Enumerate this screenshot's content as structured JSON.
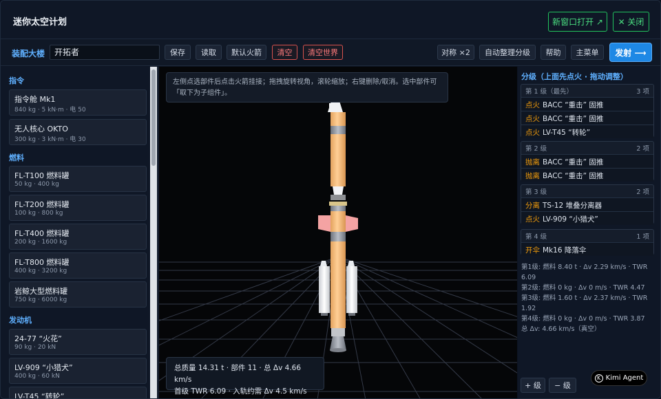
{
  "header": {
    "title": "迷你太空计划",
    "open_new_window": "新窗口打开 ↗",
    "close": "✕ 关闭"
  },
  "toolbar": {
    "vab_label": "装配大楼",
    "ship_name": "开拓者",
    "save": "保存",
    "load": "读取",
    "default_rocket": "默认火箭",
    "clear": "清空",
    "clear_world": "清空世界",
    "symmetry": "对称 ×2",
    "auto_stage": "自动整理分级",
    "help": "帮助",
    "main_menu": "主菜单",
    "launch": "发射 ⟶"
  },
  "parts_panel": {
    "categories": [
      {
        "name": "指令",
        "parts": [
          {
            "name": "指令舱 Mk1",
            "spec": "840 kg · 5 kN·m · 电 50"
          },
          {
            "name": "无人核心 OKTO",
            "spec": "300 kg · 3 kN·m · 电 30"
          }
        ]
      },
      {
        "name": "燃料",
        "parts": [
          {
            "name": "FL-T100 燃料罐",
            "spec": "50 kg · 400 kg"
          },
          {
            "name": "FL-T200 燃料罐",
            "spec": "100 kg · 800 kg"
          },
          {
            "name": "FL-T400 燃料罐",
            "spec": "200 kg · 1600 kg"
          },
          {
            "name": "FL-T800 燃料罐",
            "spec": "400 kg · 3200 kg"
          },
          {
            "name": "岩鲸大型燃料罐",
            "spec": "750 kg · 6000 kg"
          }
        ]
      },
      {
        "name": "发动机",
        "parts": [
          {
            "name": "24-77 “火花”",
            "spec": "90 kg · 20 kN"
          },
          {
            "name": "LV-909 “小猎犬”",
            "spec": "400 kg · 60 kN"
          },
          {
            "name": "LV-T45 “转轮”",
            "spec": ""
          }
        ]
      }
    ]
  },
  "viewport": {
    "hint": "左侧点选部件后点击火箭挂接；拖拽旋转视角，滚轮缩放；右键删除/取消。选中部件可「取下为子组件」。",
    "stats_line1": "总质量 14.31 t · 部件 11 · 总 Δv 4.66 km/s",
    "stats_line2": "首级 TWR 6.09 · 入轨约需 Δv 4.5 km/s"
  },
  "staging": {
    "title": "分级（上面先点火 · 拖动调整）",
    "stages": [
      {
        "label": "第 1 级（最先）",
        "count": "3 项",
        "items": [
          {
            "action": "点火",
            "part": "BACC “重击” 固推"
          },
          {
            "action": "点火",
            "part": "BACC “重击” 固推"
          },
          {
            "action": "点火",
            "part": "LV-T45 “转轮”"
          }
        ]
      },
      {
        "label": "第 2 级",
        "count": "2 项",
        "items": [
          {
            "action": "抛离",
            "part": "BACC “重击” 固推"
          },
          {
            "action": "抛离",
            "part": "BACC “重击” 固推"
          }
        ]
      },
      {
        "label": "第 3 级",
        "count": "2 项",
        "items": [
          {
            "action": "分离",
            "part": "TS-12 堆叠分离器"
          },
          {
            "action": "点火",
            "part": "LV-909 “小猎犬”"
          }
        ]
      },
      {
        "label": "第 4 级",
        "count": "1 项",
        "items": [
          {
            "action": "开伞",
            "part": "Mk16 降落伞"
          }
        ]
      }
    ],
    "summary": [
      "第1级: 燃料 8.40 t · Δv 2.29 km/s · TWR 6.09",
      "第2级: 燃料 0 kg · Δv 0 m/s · TWR 4.47",
      "第3级: 燃料 1.60 t · Δv 2.37 km/s · TWR 1.92",
      "第4级: 燃料 0 kg · Δv 0 m/s · TWR 3.87",
      "总 Δv: 4.66 km/s（真空）"
    ],
    "add_stage": "+ 级",
    "remove_stage": "− 级"
  },
  "badge": {
    "label": "Kimi Agent"
  },
  "colors": {
    "accent": "#5fb0ff",
    "green": "#22c55e",
    "danger": "#d9534f",
    "action": "#f59e0b",
    "launch": "#1e88e5"
  }
}
